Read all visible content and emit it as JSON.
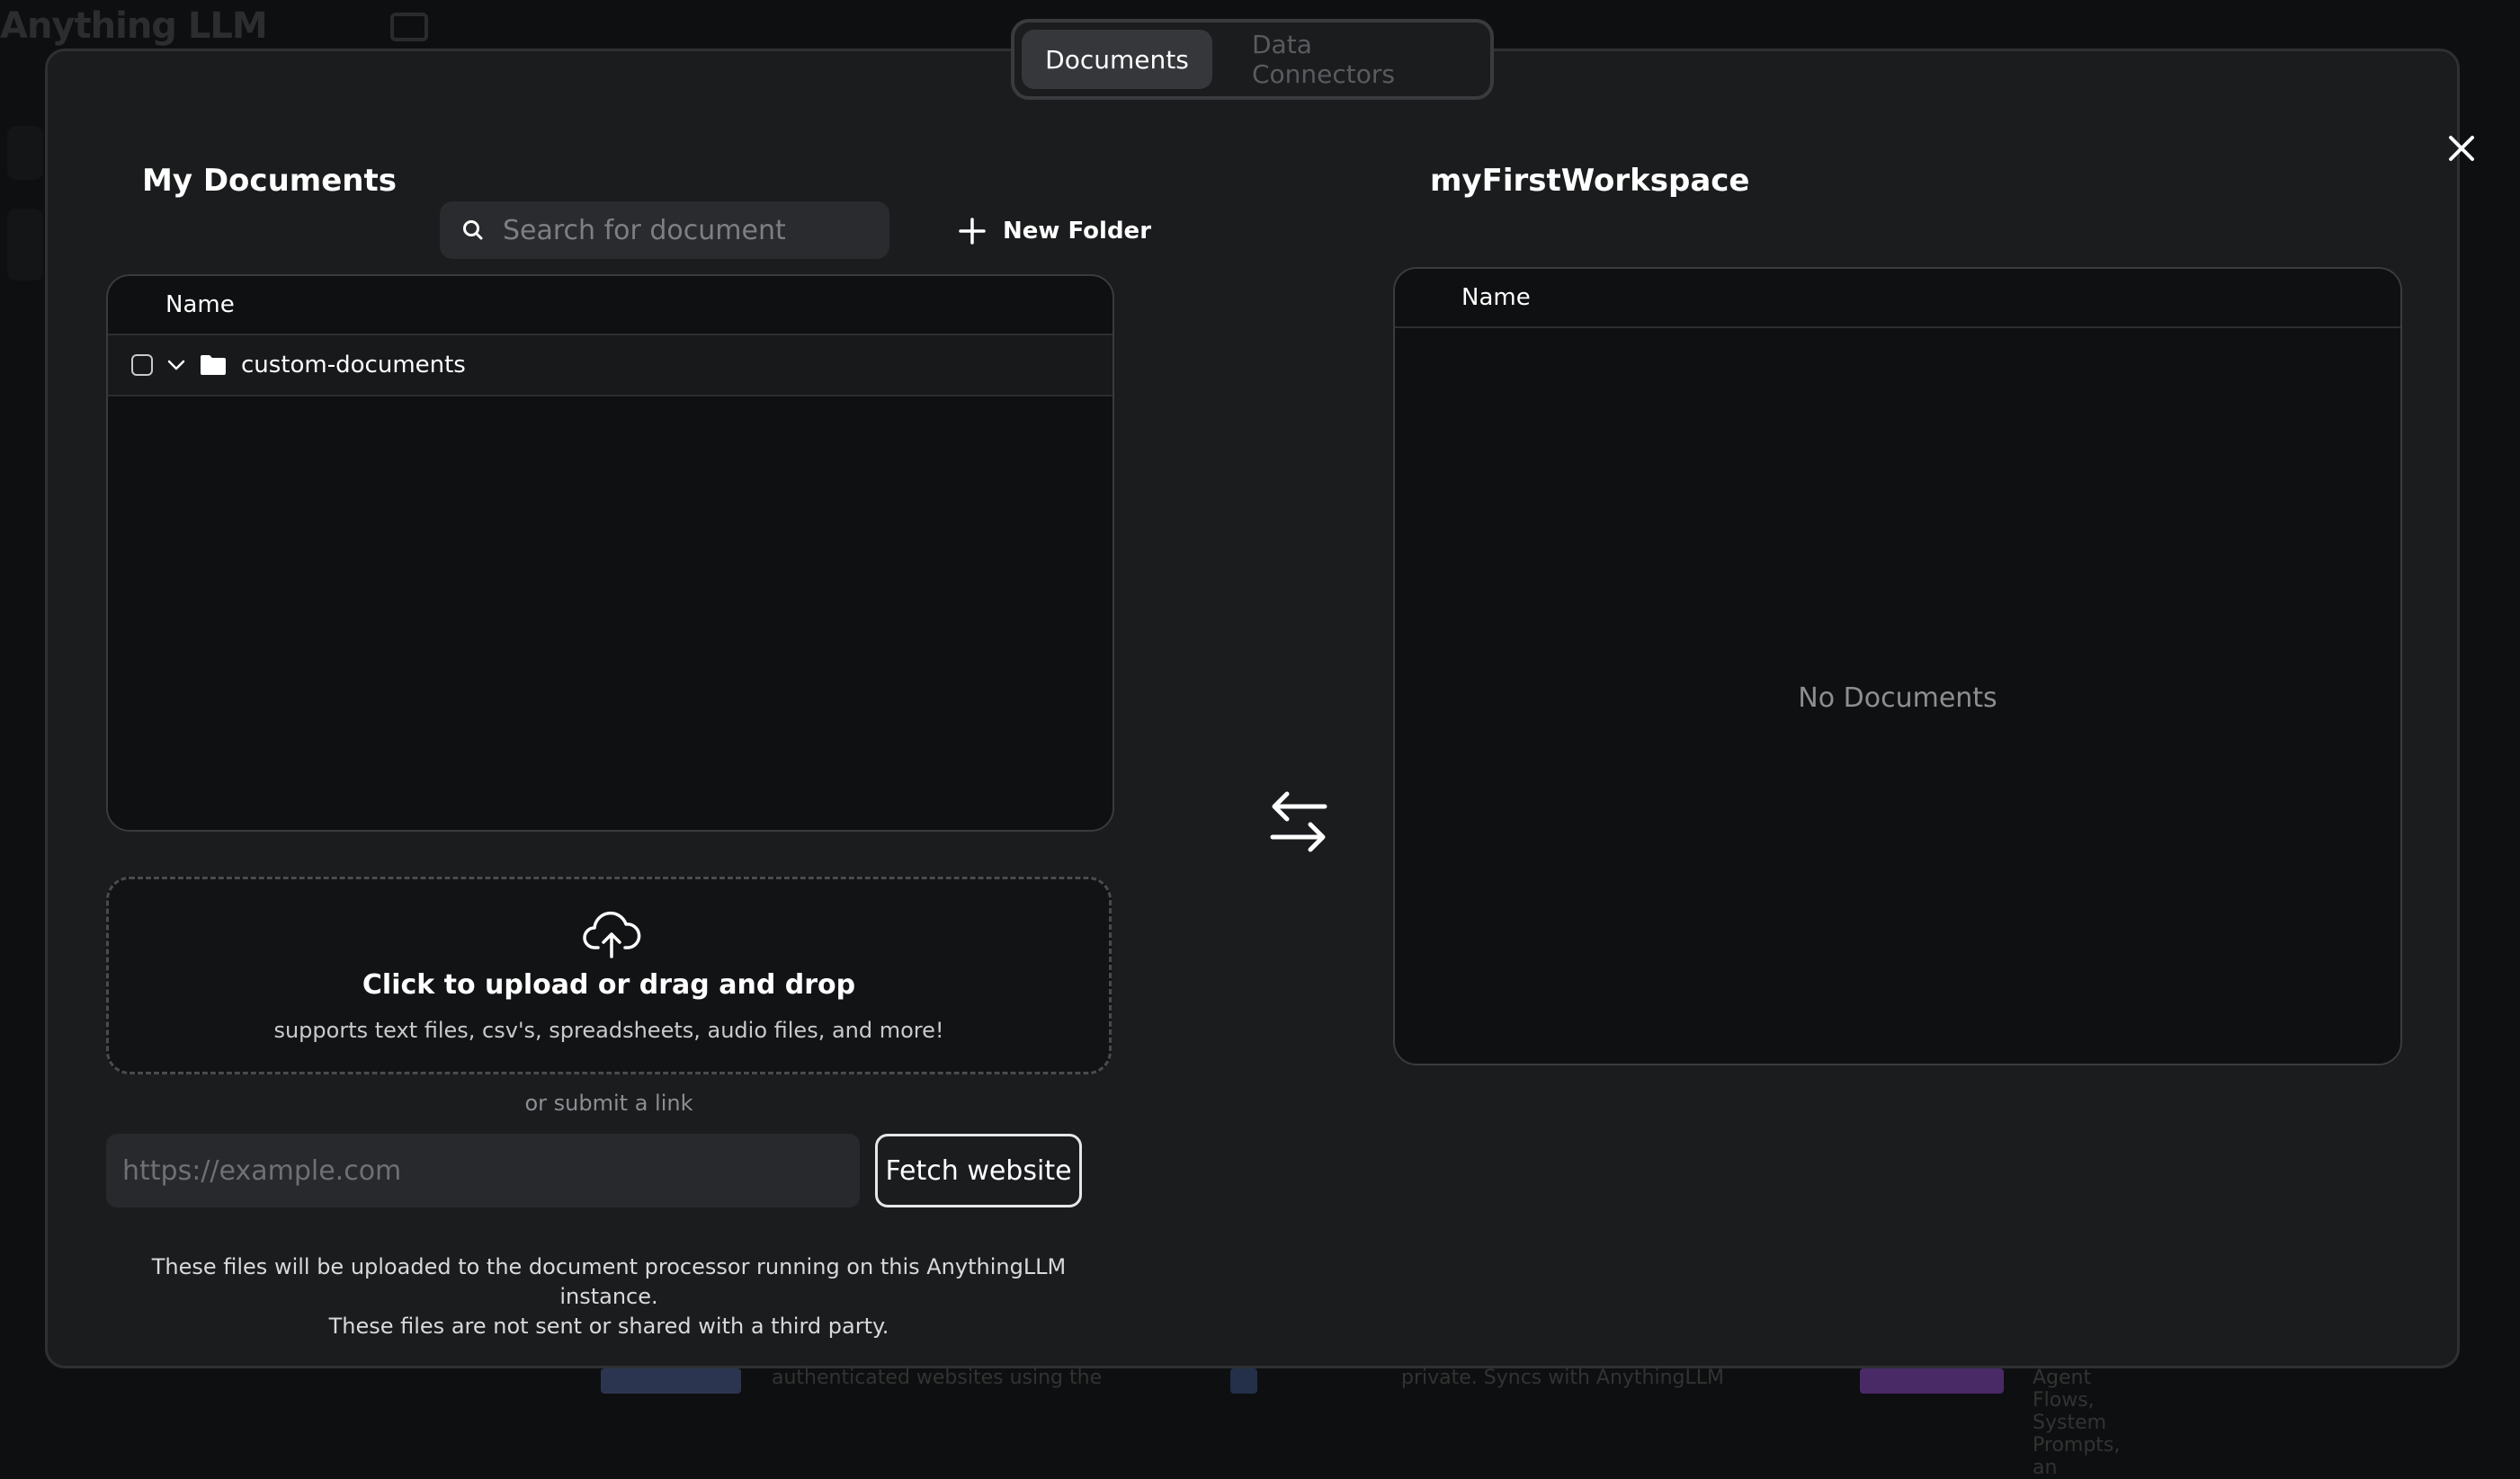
{
  "background_app": {
    "logo_text": "Anything LLM",
    "bottom_texts": [
      "authenticated websites using the",
      "private. Syncs with AnythingLLM",
      "Agent Flows, System Prompts, an"
    ]
  },
  "tabs": [
    {
      "label": "Documents",
      "active": true
    },
    {
      "label": "Data Connectors",
      "active": false
    }
  ],
  "my_documents": {
    "title": "My Documents",
    "search_placeholder": "Search for document",
    "new_folder_label": "New Folder",
    "column_name": "Name",
    "folders": [
      {
        "name": "custom-documents",
        "expanded": true,
        "checked": false
      }
    ]
  },
  "workspace": {
    "title": "myFirstWorkspace",
    "column_name": "Name",
    "empty_text": "No Documents"
  },
  "upload": {
    "title": "Click to upload or drag and drop",
    "subtitle": "supports text files, csv's, spreadsheets, audio files, and more!",
    "or_link": "or submit a link",
    "url_placeholder": "https://example.com",
    "fetch_label": "Fetch website",
    "notice_line1": "These files will be uploaded to the document processor running on this AnythingLLM instance.",
    "notice_line2": "These files are not sent or shared with a third party."
  },
  "colors": {
    "modal_bg": "#1b1c1e",
    "panel_bg": "#0f1011",
    "border": "#3a3b3e"
  }
}
